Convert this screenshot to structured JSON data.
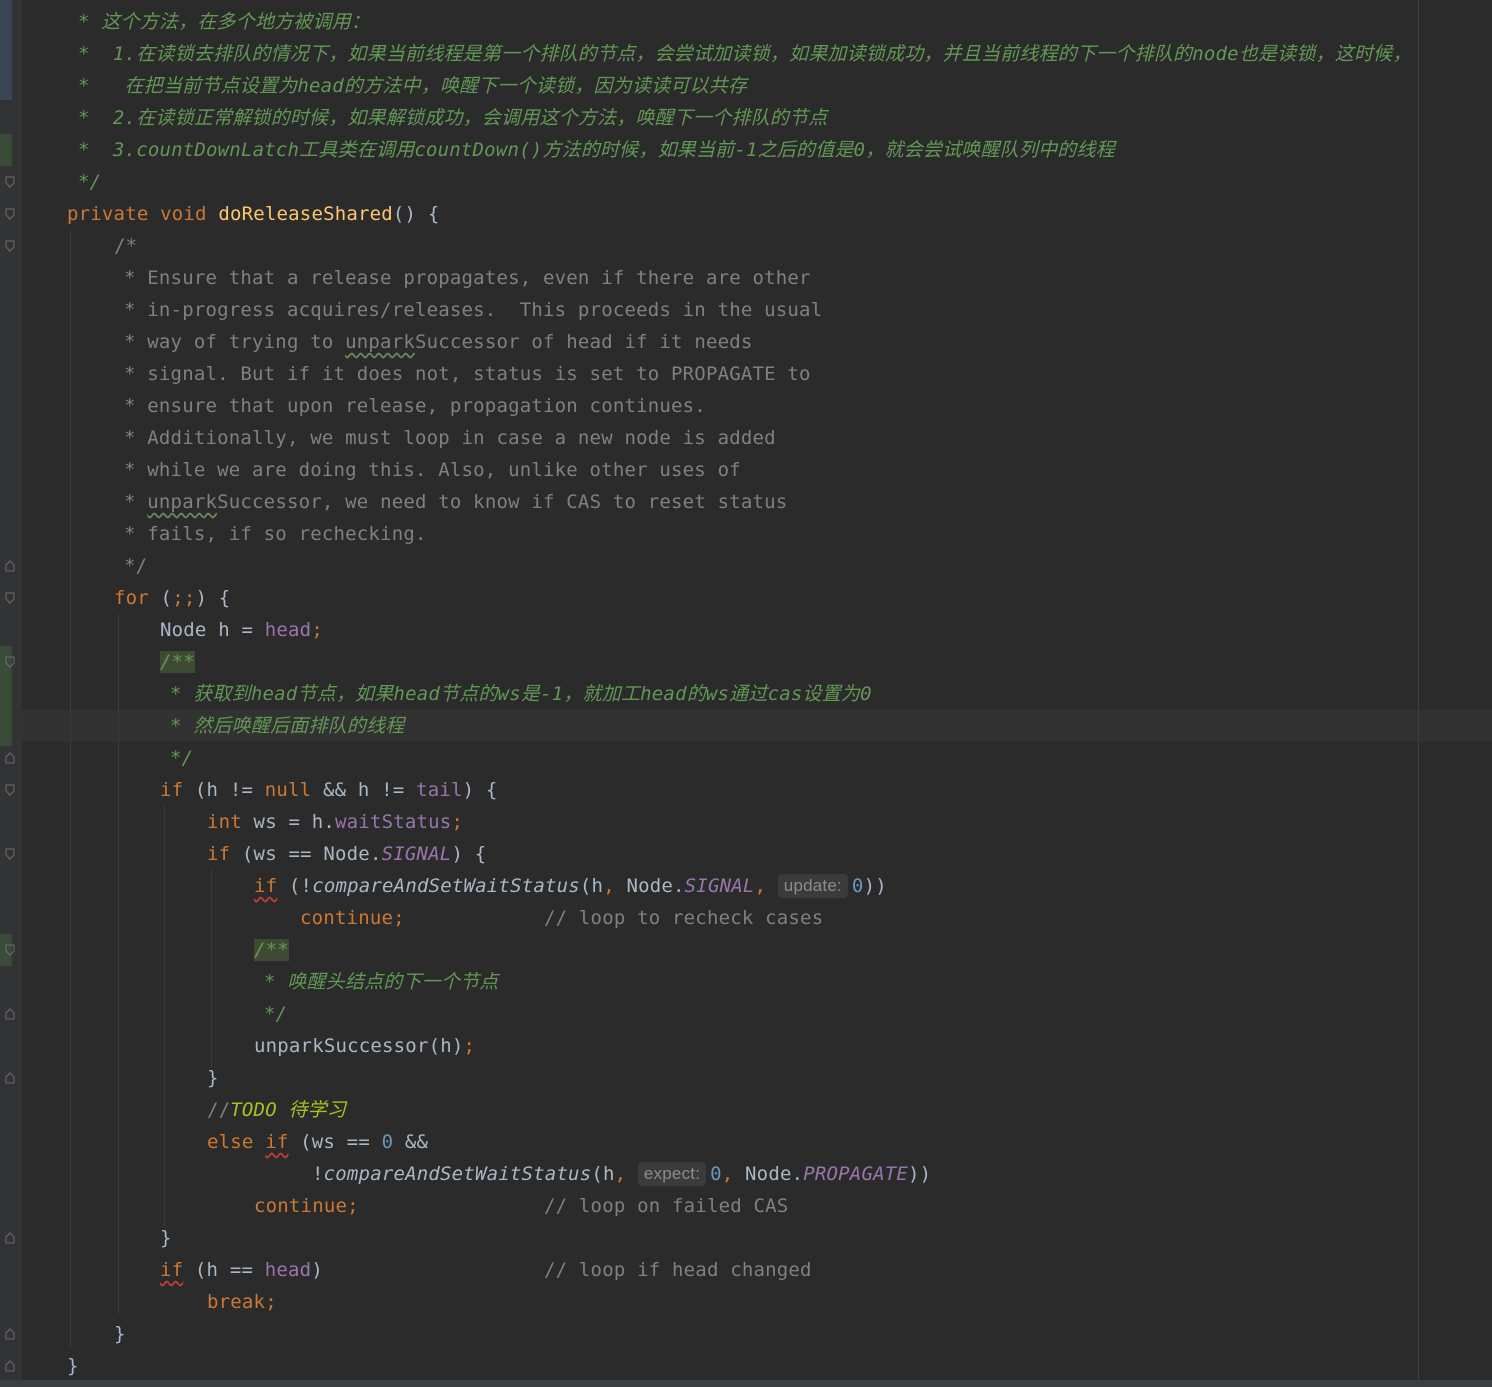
{
  "editor": {
    "language": "Java",
    "colors": {
      "background": "#2b2b2b",
      "keyword": "#cc7832",
      "method_declaration": "#ffc66d",
      "field": "#9876aa",
      "number": "#6897bb",
      "comment": "#808080",
      "doc_comment": "#629755"
    },
    "lines": {
      "l1": "* 这个方法，在多个地方被调用：",
      "l2": "*  1.在读锁去排队的情况下，如果当前线程是第一个排队的节点，会尝试加读锁，如果加读锁成功，并且当前线程的下一个排队的node也是读锁，这时候，",
      "l3": "*   在把当前节点设置为head的方法中，唤醒下一个读锁，因为读读可以共存",
      "l4": "*  2.在读锁正常解锁的时候，如果解锁成功，会调用这个方法，唤醒下一个排队的节点",
      "l5": "*  3.countDownLatch工具类在调用countDown()方法的时候，如果当前-1之后的值是0，就会尝试唤醒队列中的线程",
      "l6": "*/",
      "l7_private": "private",
      "l7_void": "void",
      "l7_name": "doReleaseShared",
      "l7_rest": "() {",
      "l8": "/*",
      "l9": "* Ensure that a release propagates, even if there are other",
      "l10": "* in-progress acquires/releases.  This proceeds in the usual",
      "l11_a": "* way of trying to ",
      "l11_b": "unpark",
      "l11_c": "Successor of head if it needs",
      "l12": "* signal. But if it does not, status is set to PROPAGATE to",
      "l13": "* ensure that upon release, propagation continues.",
      "l14": "* Additionally, we must loop in case a new node is added",
      "l15": "* while we are doing this. Also, unlike other uses of",
      "l16_a": "* ",
      "l16_b": "unpark",
      "l16_c": "Successor, we need to know if CAS to reset status",
      "l17": "* fails, if so rechecking.",
      "l18": "*/",
      "l19_for": "for",
      "l19_open": " (",
      "l19_semis": ";;",
      "l19_close": ") {",
      "l20_type": "Node h = ",
      "l20_head": "head",
      "l20_semi": ";",
      "l21": "/**",
      "l22": "* 获取到head节点，如果head节点的ws是-1，就加工head的ws通过cas设置为0",
      "l23": "* 然后唤醒后面排队的线程",
      "l24": "*/",
      "l25_if": "if",
      "l25_a": " (h != ",
      "l25_null": "null",
      "l25_b": " && h != ",
      "l25_tail": "tail",
      "l25_c": ") {",
      "l26_int": "int",
      "l26_a": " ws = h.",
      "l26_field": "waitStatus",
      "l26_semi": ";",
      "l27_if": "if",
      "l27_a": " (ws == Node.",
      "l27_signal": "SIGNAL",
      "l27_b": ") {",
      "l28_if": "if",
      "l28_a": " (!",
      "l28_method": "compareAndSetWaitStatus",
      "l28_b": "(h",
      "l28_comma1": ", ",
      "l28_c": "Node.",
      "l28_signal": "SIGNAL",
      "l28_comma2": ", ",
      "l28_hint": "update:",
      "l28_zero": "0",
      "l28_d": "))",
      "l29_continue": "continue",
      "l29_semi": ";",
      "l29_comment": "// loop to recheck cases",
      "l30": "/**",
      "l31": "* 唤醒头结点的下一个节点",
      "l32": "*/",
      "l33_a": "unparkSuccessor(h)",
      "l33_semi": ";",
      "l34": "}",
      "l35_slash": "//",
      "l35_todo": "TODO 待学习",
      "l36_else": "else",
      "l36_if": "if",
      "l36_a": " (ws == ",
      "l36_zero": "0",
      "l36_b": " &&",
      "l37_a": "!",
      "l37_method": "compareAndSetWaitStatus",
      "l37_b": "(h",
      "l37_comma1": ", ",
      "l37_hint": "expect:",
      "l37_zero": "0",
      "l37_comma2": ", ",
      "l37_c": "Node.",
      "l37_prop": "PROPAGATE",
      "l37_d": "))",
      "l38_continue": "continue",
      "l38_semi": ";",
      "l38_comment": "// loop on failed CAS",
      "l39": "}",
      "l40_if": "if",
      "l40_a": " (h == ",
      "l40_head": "head",
      "l40_b": ")",
      "l40_comment": "// loop if head changed",
      "l41_break": "break",
      "l41_semi": ";",
      "l42": "}",
      "l43": "}"
    }
  }
}
